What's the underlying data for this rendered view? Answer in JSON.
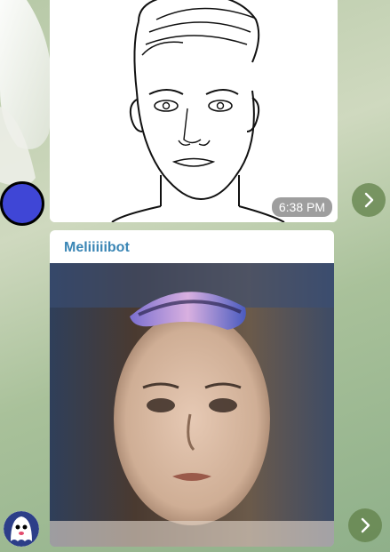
{
  "chat": {
    "messages": [
      {
        "type": "photo",
        "time": "6:38 PM"
      },
      {
        "type": "photo",
        "sender": "Meliiiiibot"
      }
    ]
  },
  "icons": {
    "forward": "chevron-right-icon",
    "avatar_user": "blue-circle-avatar",
    "avatar_bot": "ghost-avatar"
  },
  "colors": {
    "sender_name": "#3a86b5",
    "avatar_user": "#3f46d6",
    "forward_button": "#60804a"
  }
}
